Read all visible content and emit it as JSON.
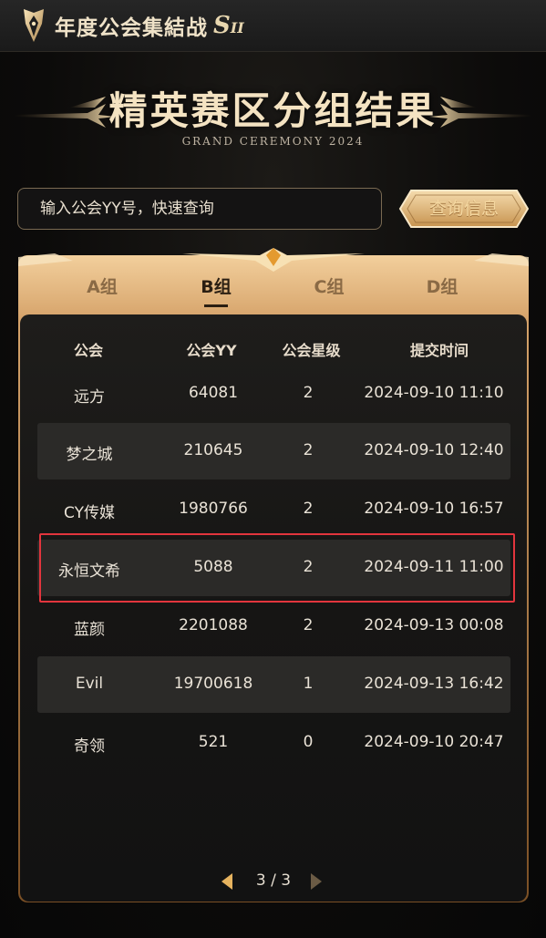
{
  "header": {
    "app_title": "年度公会集結战",
    "season_s": "S",
    "season_num": "II"
  },
  "hero": {
    "title": "精英赛区分组结果",
    "subtitle": "GRAND CEREMONY 2024"
  },
  "search": {
    "placeholder": "输入公会YY号，快速查询",
    "button_label": "查询信息"
  },
  "tabs": [
    {
      "label": "A组",
      "active": false
    },
    {
      "label": "B组",
      "active": true
    },
    {
      "label": "C组",
      "active": false
    },
    {
      "label": "D组",
      "active": false
    }
  ],
  "table": {
    "columns": [
      "公会",
      "公会YY",
      "公会星级",
      "提交时间"
    ],
    "rows": [
      {
        "guild": "远方",
        "yy": "64081",
        "stars": "2",
        "time": "2024-09-10 11:10"
      },
      {
        "guild": "梦之城",
        "yy": "210645",
        "stars": "2",
        "time": "2024-09-10 12:40"
      },
      {
        "guild": "CY传媒",
        "yy": "1980766",
        "stars": "2",
        "time": "2024-09-10 16:57"
      },
      {
        "guild": "永恒文希",
        "yy": "5088",
        "stars": "2",
        "time": "2024-09-11 11:00"
      },
      {
        "guild": "蓝颜",
        "yy": "2201088",
        "stars": "2",
        "time": "2024-09-13 00:08"
      },
      {
        "guild": "Evil",
        "yy": "19700618",
        "stars": "1",
        "time": "2024-09-13 16:42"
      },
      {
        "guild": "奇领",
        "yy": "521",
        "stars": "0",
        "time": "2024-09-10 20:47"
      }
    ]
  },
  "pagination": {
    "current": "3",
    "separator": "/",
    "total": "3"
  },
  "colors": {
    "gold": "#e9c48a",
    "highlight_border": "#e3353d",
    "background": "#0c0b0a"
  }
}
